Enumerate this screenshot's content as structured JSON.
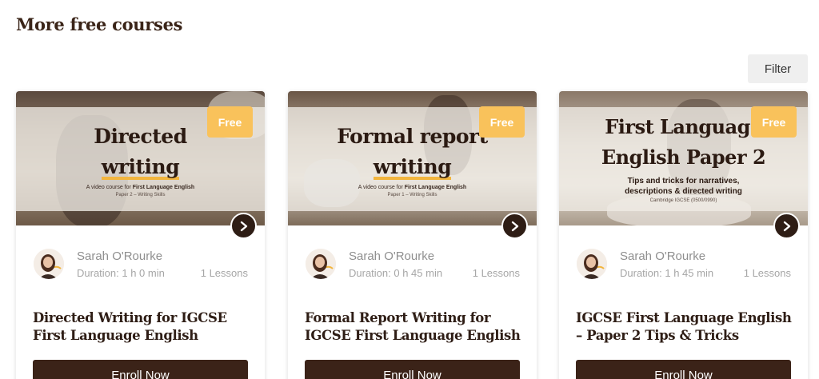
{
  "section": {
    "title": "More free courses"
  },
  "filter": {
    "label": "Filter"
  },
  "courses": [
    {
      "thumb_line1": "Directed",
      "thumb_line2": "writing",
      "thumb_sub_prefix": "A video course for ",
      "thumb_sub_bold": "First Language English",
      "thumb_sub2": "Paper 2 – Writing Skills",
      "badge": "Free",
      "author": "Sarah O'Rourke",
      "duration": "Duration: 1 h 0 min",
      "lessons": "1 Lessons",
      "title": "Directed Writing for IGCSE First Language English",
      "enroll": "Enroll Now"
    },
    {
      "thumb_line1": "Formal report",
      "thumb_line2": "writing",
      "thumb_sub_prefix": "A video course for ",
      "thumb_sub_bold": "First Language English",
      "thumb_sub2": "Paper 1 – Writing Skills",
      "badge": "Free",
      "author": "Sarah O'Rourke",
      "duration": "Duration: 0 h 45 min",
      "lessons": "1 Lessons",
      "title": "Formal Report Writing for IGCSE First Language English",
      "enroll": "Enroll Now"
    },
    {
      "thumb_line1": "First Language",
      "thumb_line2": "English Paper 2",
      "thumb_tips1": "Tips and tricks for narratives,",
      "thumb_tips2": "descriptions & directed writing",
      "thumb_sub2": "Cambridge IGCSE (0500/0990)",
      "badge": "Free",
      "author": "Sarah O'Rourke",
      "duration": "Duration: 1 h 45 min",
      "lessons": "1 Lessons",
      "title": "IGCSE First Language English – Paper 2 Tips & Tricks",
      "enroll": "Enroll Now"
    }
  ],
  "colors": {
    "brand_dark": "#3b2318",
    "badge": "#f9c25b",
    "highlight": "#f2b53e"
  },
  "icons": {
    "arrow": "chevron-right-icon"
  }
}
